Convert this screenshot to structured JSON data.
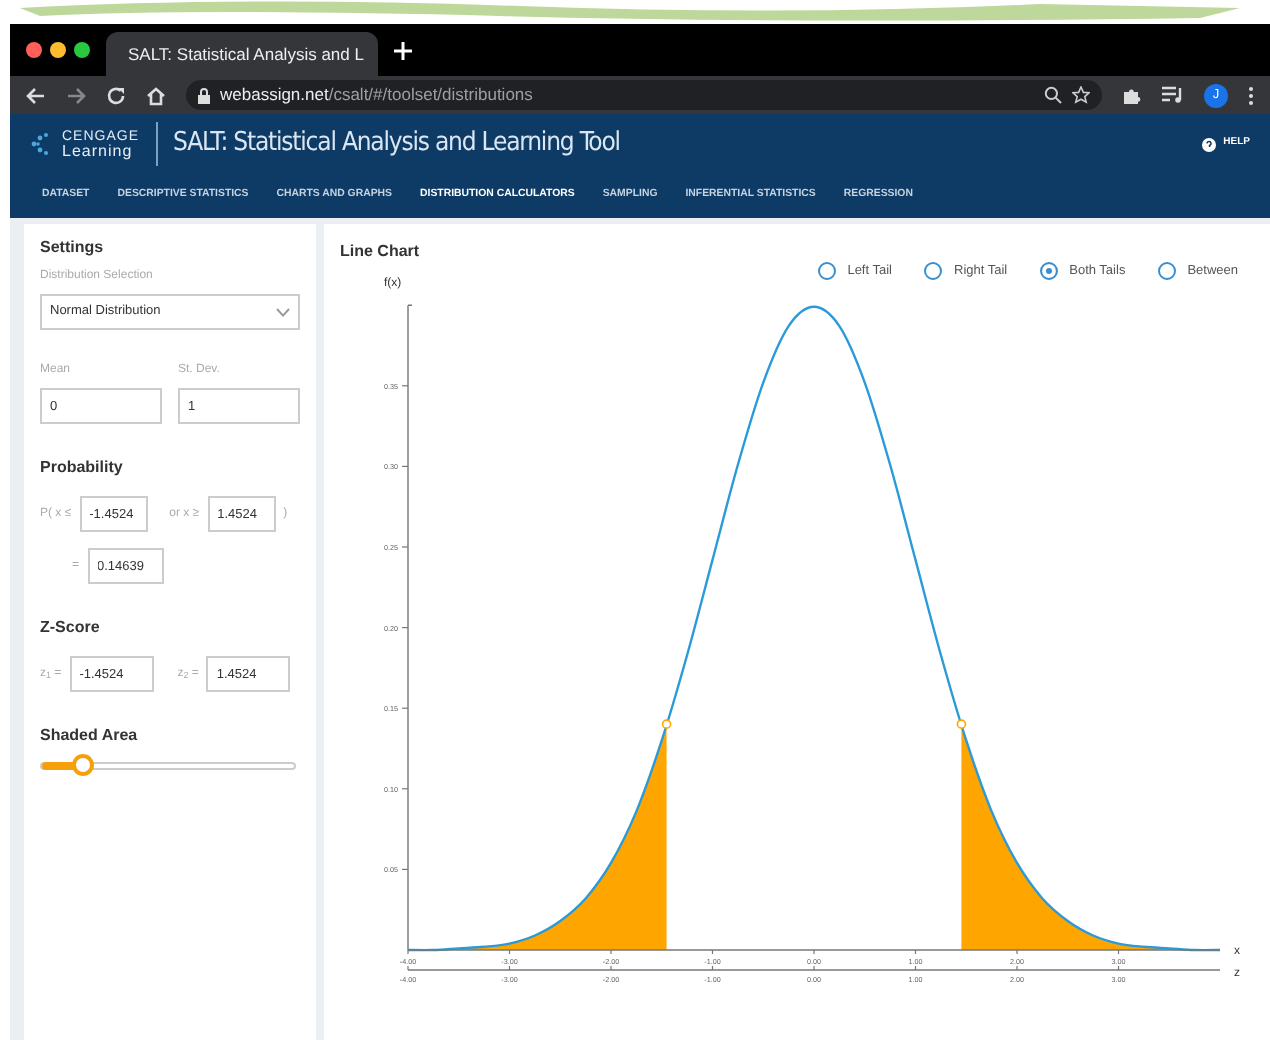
{
  "browser": {
    "tab_title": "SALT: Statistical Analysis and L",
    "url_domain": "webassign.net",
    "url_path": "/csalt/#/toolset/distributions",
    "profile_initial": "J"
  },
  "app": {
    "logo_top": "CENGAGE",
    "logo_bottom": "Learning",
    "title": "SALT: Statistical Analysis and Learning Tool",
    "help": "HELP"
  },
  "nav": [
    {
      "label": "DATASET",
      "selected": false
    },
    {
      "label": "DESCRIPTIVE STATISTICS",
      "selected": false
    },
    {
      "label": "CHARTS AND GRAPHS",
      "selected": false
    },
    {
      "label": "DISTRIBUTION CALCULATORS",
      "selected": true
    },
    {
      "label": "SAMPLING",
      "selected": false
    },
    {
      "label": "INFERENTIAL STATISTICS",
      "selected": false
    },
    {
      "label": "REGRESSION",
      "selected": false
    }
  ],
  "settings": {
    "title": "Settings",
    "distribution_label": "Distribution Selection",
    "distribution": "Normal Distribution",
    "mean_label": "Mean",
    "mean": "0",
    "sd_label": "St. Dev.",
    "sd": "1"
  },
  "probability": {
    "title": "Probability",
    "lower_label": "P( x ≤",
    "lower": "-1.4524",
    "upper_label": "or x ≥",
    "upper": "1.4524",
    "close": ")",
    "equals": "=",
    "result": "0.14639"
  },
  "z_score": {
    "title": "Z-Score",
    "z1_label": "z$_{1}$ =",
    "z1": "-1.4524",
    "z2_label": "z$_{2}$ =",
    "z2": "1.4524"
  },
  "shaded_area": {
    "title": "Shaded Area",
    "level": 0.16
  },
  "chart": {
    "title": "Line Chart",
    "tails": [
      {
        "label": "Left Tail",
        "selected": false
      },
      {
        "label": "Right Tail",
        "selected": false
      },
      {
        "label": "Both Tails",
        "selected": true
      },
      {
        "label": "Between",
        "selected": false
      }
    ],
    "chart_data": {
      "type": "line",
      "xlabel": "x",
      "ylabel": "f(x)",
      "x": [
        -4,
        -3.75,
        -3.5,
        -3.25,
        -3,
        -2.75,
        -2.5,
        -2.25,
        -2,
        -1.75,
        -1.5,
        -1.25,
        -1,
        -0.75,
        -0.5,
        -0.25,
        0,
        0.25,
        0.5,
        0.75,
        1,
        1.25,
        1.5,
        1.75,
        2,
        2.25,
        2.5,
        2.75,
        3,
        3.25,
        3.5,
        3.75,
        4
      ],
      "series": [
        {
          "color": "#2b9ad8",
          "values": [
            0,
            0,
            0.001,
            0.002,
            0.004,
            0.009,
            0.018,
            0.032,
            0.054,
            0.086,
            0.13,
            0.183,
            0.242,
            0.301,
            0.352,
            0.387,
            0.399,
            0.387,
            0.352,
            0.301,
            0.242,
            0.183,
            0.13,
            0.086,
            0.054,
            0.032,
            0.018,
            0.009,
            0.004,
            0.002,
            0.001,
            0,
            0
          ]
        }
      ],
      "xlim": [
        -4,
        4
      ],
      "ylim": [
        0,
        0.4
      ],
      "xticks": [
        {
          "value": -4,
          "label": "-4.00"
        },
        {
          "value": -3,
          "label": "-3.00"
        },
        {
          "value": -2,
          "label": "-2.00"
        },
        {
          "value": -1,
          "label": "-1.00"
        },
        {
          "value": 0,
          "label": "0.00"
        },
        {
          "value": 1,
          "label": "1.00"
        },
        {
          "value": 2,
          "label": "2.00"
        },
        {
          "value": 3,
          "label": "3.00"
        }
      ],
      "yticks": [
        {
          "value": 0.05,
          "label": "0.05"
        },
        {
          "value": 0.1,
          "label": "0.10"
        },
        {
          "value": 0.15,
          "label": "0.15"
        },
        {
          "value": 0.2,
          "label": "0.20"
        },
        {
          "value": 0.25,
          "label": "0.25"
        },
        {
          "value": 0.3,
          "label": "0.30"
        },
        {
          "value": 0.35,
          "label": "0.35"
        }
      ]
    },
    "z_axis": {
      "label": "z",
      "ticks": [
        "-4.00",
        "-3.00",
        "-2.00",
        "-1.00",
        "0.00",
        "1.00",
        "2.00",
        "3.00"
      ]
    }
  }
}
